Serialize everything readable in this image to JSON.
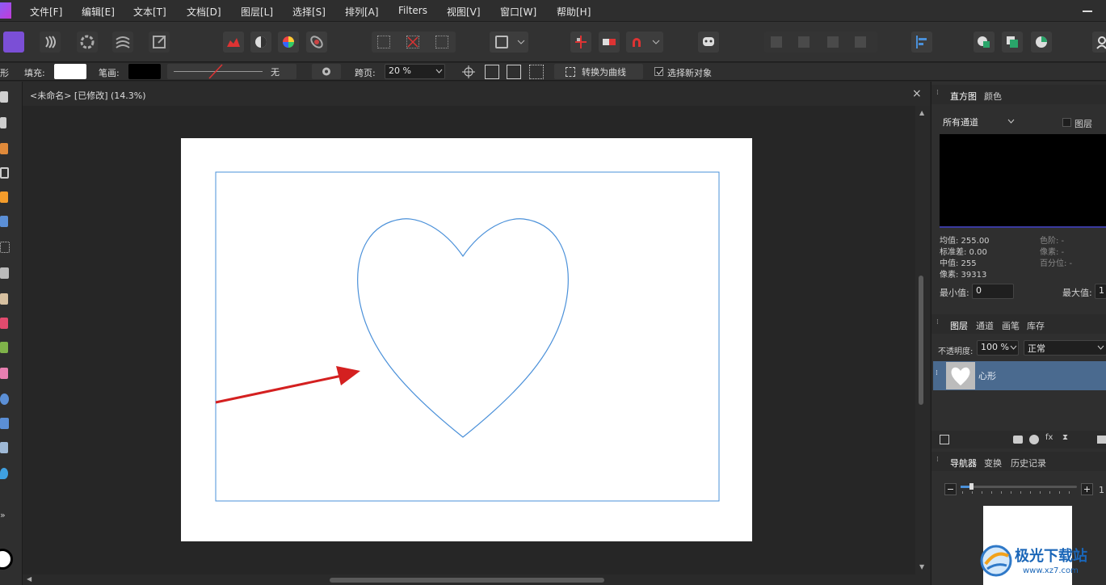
{
  "menu": {
    "items": [
      "文件[F]",
      "编辑[E]",
      "文本[T]",
      "文档[D]",
      "图层[L]",
      "选择[S]",
      "排列[A]",
      "Filters",
      "视图[V]",
      "窗口[W]",
      "帮助[H]"
    ]
  },
  "context_bar": {
    "partial_label": "形",
    "fill_label": "填充:",
    "stroke_label": "笔画:",
    "stroke_none": "无",
    "span_label": "跨页:",
    "span_value": "20 %",
    "convert_button": "转换为曲线",
    "select_new_label": "选择新对象"
  },
  "document": {
    "tab_title": "<未命名> [已修改] (14.3%)"
  },
  "histogram_panel": {
    "tabs": [
      "直方图",
      "颜色"
    ],
    "channel": "所有通道",
    "layer_checkbox": "图层",
    "stats_left": [
      "均值: 255.00",
      "标准差: 0.00",
      "中值: 255",
      "像素: 39313"
    ],
    "stats_right": [
      "色阶: -",
      "像素: -",
      "百分位: -"
    ],
    "min_label": "最小值:",
    "min_value": "0",
    "max_label": "最大值:",
    "max_value": "1"
  },
  "layers_panel": {
    "tabs": [
      "图层",
      "通道",
      "画笔",
      "库存"
    ],
    "opacity_label": "不透明度:",
    "opacity_value": "100 %",
    "blend_mode": "正常",
    "layer_name": "心形"
  },
  "navigator_panel": {
    "tabs": [
      "导航器",
      "变换",
      "历史记录"
    ],
    "zoom_value": "1"
  },
  "watermark": {
    "text": "极光下载站",
    "url": "www.xz7.com"
  },
  "colors": {
    "accent": "#4a90d9",
    "selection_row": "#4a6a8f",
    "arrow": "#d42020"
  }
}
